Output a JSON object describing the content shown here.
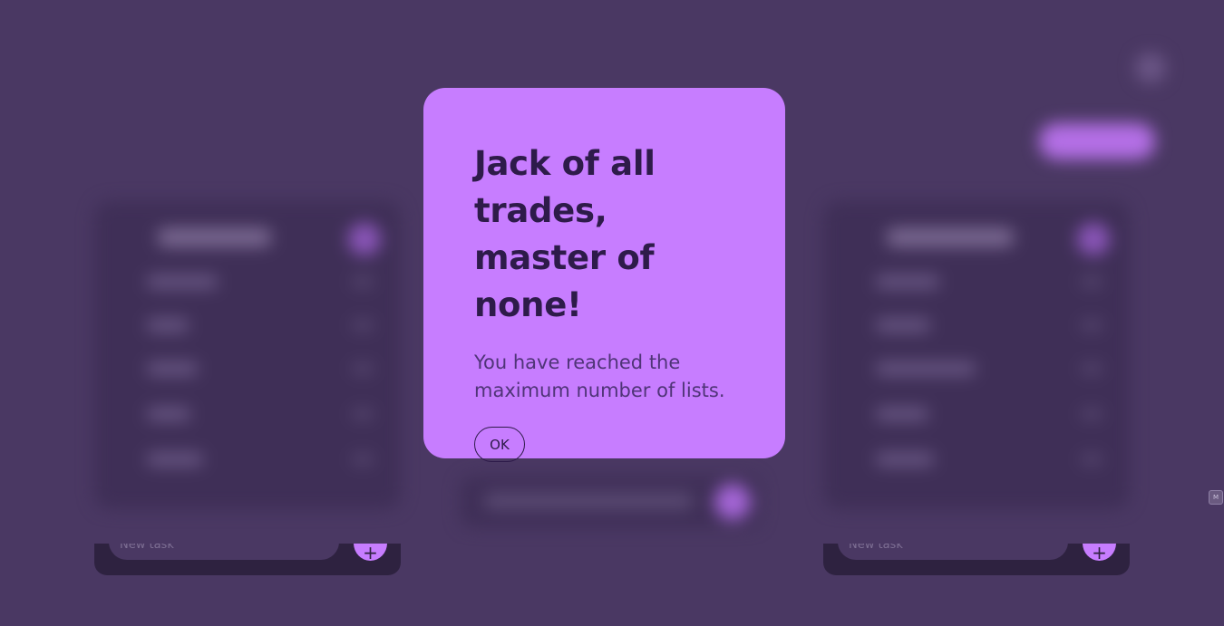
{
  "modal": {
    "title": "Jack of all trades, master of none!",
    "message": "You have reached the maximum number of lists.",
    "ok_label": "OK"
  },
  "footer": {
    "new_task_placeholder": "New task",
    "add_label": "+"
  },
  "colors": {
    "background": "#4a3863",
    "modal_bg": "#c77dff",
    "modal_text": "#2e1b4a",
    "accent": "#c77dff",
    "card_bg": "#3f2f57"
  },
  "icons": {
    "side_widget": "m-icon"
  }
}
